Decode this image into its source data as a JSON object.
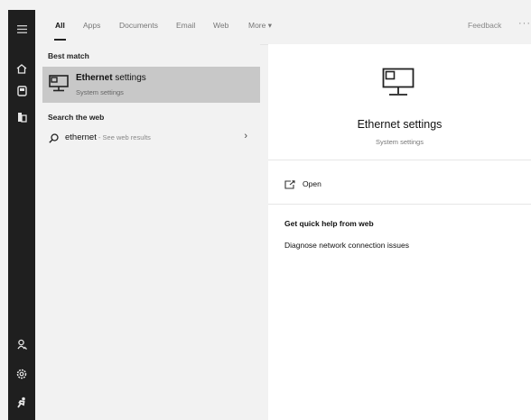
{
  "tabs": [
    {
      "label": "All"
    },
    {
      "label": "Apps"
    },
    {
      "label": "Documents"
    },
    {
      "label": "Email"
    },
    {
      "label": "Web"
    },
    {
      "label": "More ▾"
    }
  ],
  "feedback_label": "Feedback",
  "more_options": "···",
  "rail_icons": [
    "menu-icon",
    "home-icon",
    "document-icon",
    "app-icon",
    "user-icon",
    "settings-icon",
    "run-icon"
  ],
  "left": {
    "best_match_header": "Best match",
    "best_match": {
      "title_bold": "Ethernet",
      "title_rest": " settings",
      "subtitle": "System settings"
    },
    "search_web_header": "Search the web",
    "web_result": {
      "query": "ethernet",
      "suffix": " - See web results",
      "chevron": "›"
    }
  },
  "preview": {
    "title": "Ethernet settings",
    "subtitle": "System settings",
    "open_label": "Open",
    "help_header": "Get quick help from web",
    "help_links": [
      "Diagnose network connection issues"
    ]
  },
  "colors": {
    "rail": "#1f1f1f",
    "selected": "#c8c8c8",
    "panel": "#f2f2f2"
  }
}
